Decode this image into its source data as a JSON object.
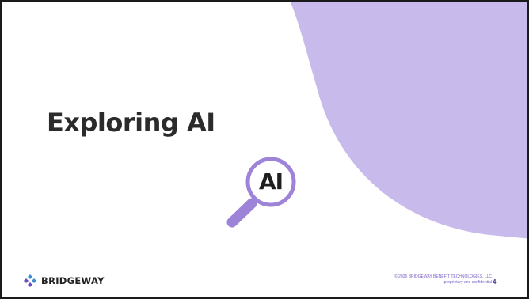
{
  "slide": {
    "title": "Exploring AI",
    "icon_text": "AI",
    "footer": {
      "logo_text": "BRIDGEWAY",
      "copyright_line1": "© 2026 BRIDGEWAY BENEFIT TECHNOLOGIES, LLC",
      "copyright_line2": "proprietary and confidential",
      "page_number": "4"
    }
  },
  "colors": {
    "accent_purple": "#c8bbec",
    "icon_purple": "#9e84d9",
    "text_dark": "#2b2b2b",
    "logo_blue": "#3b8fd9",
    "logo_purple": "#6b4fc2"
  },
  "icons": {
    "magnifier": "magnifying-glass-icon",
    "logo": "bridgeway-logo-icon"
  }
}
